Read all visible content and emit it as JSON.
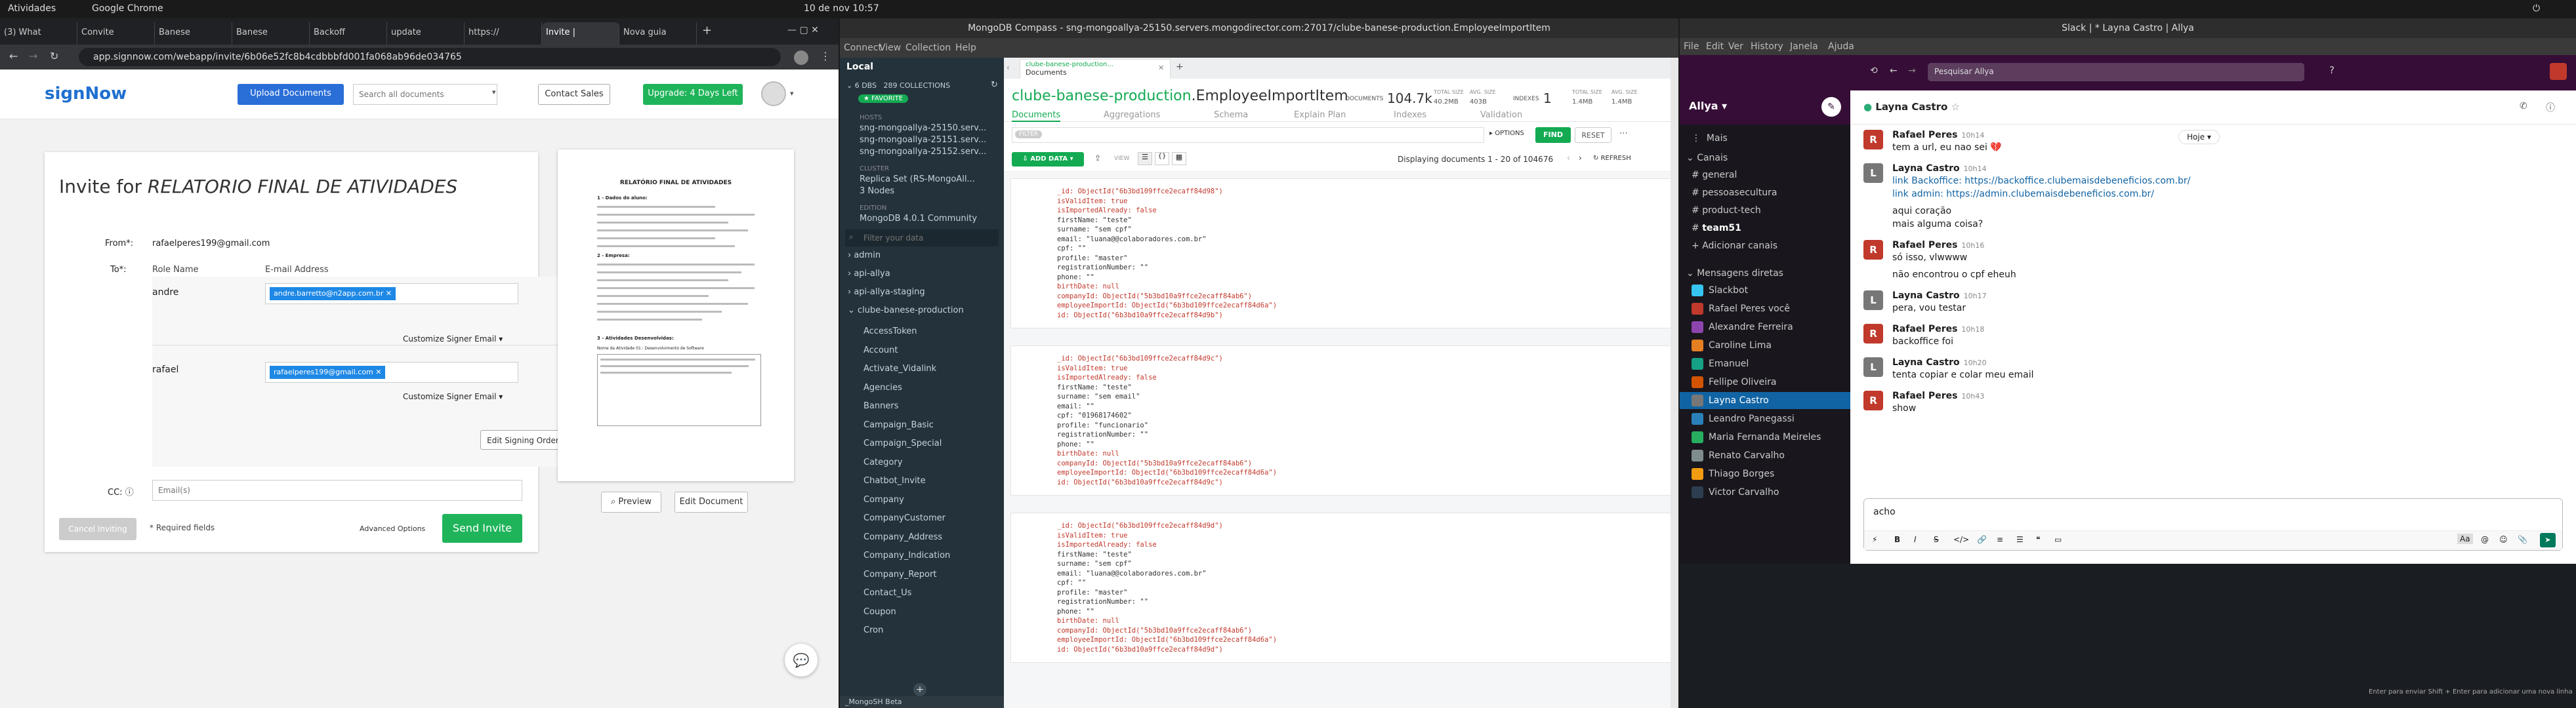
{
  "os_bar": {
    "activities": "Atividades",
    "app": "Google Chrome",
    "datetime": "10 de nov  10:57"
  },
  "chrome": {
    "tabs": [
      "(3) What",
      "Convite",
      "Banese",
      "Banese",
      "Backoff",
      "update",
      "https://",
      "Invite |",
      "Nova guia"
    ],
    "url": "app.signnow.com/webapp/invite/6b06e52fc8b4cdbbbfd001fa068ab96de034765"
  },
  "signnow": {
    "logo": "signNow",
    "upload_button": "Upload Documents",
    "search_placeholder": "Search all documents",
    "contact_sales": "Contact Sales",
    "upgrade_button": "Upgrade: 4 Days Left",
    "invite_title_prefix": "Invite for",
    "invite_title_doc": "RELATORIO FINAL DE ATIVIDADES",
    "from_label": "From*:",
    "from_value": "rafaelperes199@gmail.com",
    "to_label": "To*:",
    "role_name_header": "Role Name",
    "email_header": "E-mail Address",
    "signers": [
      {
        "role": "andre",
        "email": "andre.barretto@n2app.com.br",
        "customize": "Customize Signer Email"
      },
      {
        "role": "rafael",
        "email": "rafaelperes199@gmail.com",
        "customize": "Customize Signer Email"
      }
    ],
    "edit_signing_order": "Edit Signing Order",
    "cc_label": "CC:",
    "cc_placeholder": "Email(s)",
    "cancel_button": "Cancel Inviting",
    "required_note": "* Required fields",
    "advanced_options": "Advanced Options",
    "send_invite": "Send Invite",
    "preview_button": "Preview",
    "edit_document_button": "Edit Document",
    "preview_doc_title": "RELATÓRIO FINAL DE ATIVIDADES",
    "preview_section1": "1 - Dados do aluno:",
    "preview_section2": "2 - Empresa:",
    "preview_section3": "3 - Atividades Desenvolvidas:",
    "preview_area": "Nome da Atividade 01 : Desenvolvimento de Software"
  },
  "compass": {
    "title": "MongoDB Compass - sng-mongoallya-25150.servers.mongodirector.com:27017/clube-banese-production.EmployeeImportItem",
    "menu": [
      "Connect",
      "View",
      "Collection",
      "Help"
    ],
    "sidebar": {
      "local": "Local",
      "dbs": "6 DBS",
      "collections": "289 COLLECTIONS",
      "favorite": "FAVORITE",
      "hosts_label": "HOSTS",
      "hosts": [
        "sng-mongoallya-25150.serv...",
        "sng-mongoallya-25151.serv...",
        "sng-mongoallya-25152.serv..."
      ],
      "cluster_label": "CLUSTER",
      "cluster": "Replica Set (RS-MongoAll...",
      "nodes": "3 Nodes",
      "edition_label": "EDITION",
      "edition": "MongoDB 4.0.1 Community",
      "filter_placeholder": "Filter your data",
      "databases": [
        "admin",
        "api-allya",
        "api-allya-staging",
        "clube-banese-production"
      ],
      "collections_list": [
        "AccessToken",
        "Account",
        "Activate_Vidalink",
        "Agencies",
        "Banners",
        "Campaign_Basic",
        "Campaign_Special",
        "Category",
        "Chatbot_Invite",
        "Company",
        "CompanyCustomer",
        "Company_Address",
        "Company_Indication",
        "Company_Report",
        "Contact_Us",
        "Coupon",
        "Cron"
      ],
      "mongosh": "_MongoSH Beta"
    },
    "tab_title": "clube-banese-production...",
    "tab_sub": "Documents",
    "ns_db": "clube-banese-production",
    "ns_coll": ".EmployeeImportItem",
    "documents_label": "DOCUMENTS",
    "documents_count": "104.7k",
    "total_size_label": "TOTAL SIZE",
    "total_size": "40.2MB",
    "avg_size_label": "AVG. SIZE",
    "avg_size": "403B",
    "indexes_label": "INDEXES",
    "indexes_count": "1",
    "total_isize_label": "TOTAL SIZE",
    "total_isize": "1.4MB",
    "avg_isize_label": "AVG. SIZE",
    "avg_isize": "1.4MB",
    "subtabs": [
      "Documents",
      "Aggregations",
      "Schema",
      "Explain Plan",
      "Indexes",
      "Validation"
    ],
    "filter_tag": "FILTER",
    "options": "OPTIONS",
    "find": "FIND",
    "reset": "RESET",
    "add_data": "ADD DATA",
    "view_label": "VIEW",
    "displaying": "Displaying documents 1 - 20 of 104676",
    "refresh": "REFRESH",
    "docs": [
      [
        "_id: ObjectId(\"6b3bd109ffce2ecaff84d98\")",
        "isValidItem: true",
        "isImportedAlready: false",
        "firstName: \"teste\"",
        "surname: \"sem cpf\"",
        "email: \"luana@@colaboradores.com.br\"",
        "cpf: \"\"",
        "profile: \"master\"",
        "registrationNumber: \"\"",
        "phone: \"\"",
        "birthDate: null",
        "companyId: ObjectId(\"5b3bd10a9ffce2ecaff84ab6\")",
        "employeeImportId: ObjectId(\"6b3bd109ffce2ecaff84d6a\")",
        "id: ObjectId(\"6b3bd10a9ffce2ecaff84d9b\")"
      ],
      [
        "_id: ObjectId(\"6b3bd109ffce2ecaff84d9c\")",
        "isValidItem: true",
        "isImportedAlready: false",
        "firstName: \"teste\"",
        "surname: \"sem email\"",
        "email: \"\"",
        "cpf: \"01968174602\"",
        "profile: \"funcionario\"",
        "registrationNumber: \"\"",
        "phone: \"\"",
        "birthDate: null",
        "companyId: ObjectId(\"5b3bd10a9ffce2ecaff84ab6\")",
        "employeeImportId: ObjectId(\"6b3bd109ffce2ecaff84d6a\")",
        "id: ObjectId(\"6b3bd10a9ffce2ecaff84d9c\")"
      ],
      [
        "_id: ObjectId(\"6b3bd109ffce2ecaff84d9d\")",
        "isValidItem: true",
        "isImportedAlready: false",
        "firstName: \"teste\"",
        "surname: \"sem cpf\"",
        "email: \"luana@@colaboradores.com.br\"",
        "cpf: \"\"",
        "profile: \"master\"",
        "registrationNumber: \"\"",
        "phone: \"\"",
        "birthDate: null",
        "companyId: ObjectId(\"5b3bd10a9ffce2ecaff84ab6\")",
        "employeeImportId: ObjectId(\"6b3bd109ffce2ecaff84d6a\")",
        "id: ObjectId(\"6b3bd10a9ffce2ecaff84d9d\")"
      ]
    ]
  },
  "slack": {
    "title": "Slack | * Layna Castro | Allya",
    "menu": [
      "File",
      "Edit",
      "Ver",
      "History",
      "Janela",
      "Ajuda"
    ],
    "search": "Pesquisar Allya",
    "workspace": "Allya",
    "more": "Mais",
    "channels_header": "Canais",
    "channels": [
      "general",
      "pessoasecultura",
      "product-tech",
      "team51",
      "Adicionar canais"
    ],
    "dm_header": "Mensagens diretas",
    "dms": [
      "Slackbot",
      "Rafael Peres  você",
      "Alexandre Ferreira",
      "Caroline Lima",
      "Emanuel",
      "Fellipe Oliveira",
      "Layna Castro",
      "Leandro Panegassi",
      "Maria Fernanda Meireles",
      "Renato Carvalho",
      "Thiago Borges",
      "Victor Carvalho"
    ],
    "channel_name": "Layna Castro",
    "date_chip": "Hoje",
    "messages": [
      {
        "author": "Rafael Peres",
        "time": "10h14",
        "lines": [
          "tem a url, eu nao sei 💔"
        ],
        "color": "#c0392b",
        "initial": "R"
      },
      {
        "author": "Layna Castro",
        "time": "10h14",
        "lines": [
          "link Backoffice: https://backoffice.clubemaisdebeneficios.com.br/",
          "link admin: https://admin.clubemaisdebeneficios.com.br/",
          "",
          "aqui coração",
          "mais alguma coisa?"
        ],
        "color": "#777",
        "initial": "L"
      },
      {
        "author": "Rafael Peres",
        "time": "10h16",
        "lines": [
          "só isso, vlwwww",
          "",
          "não encontrou o cpf eheuh"
        ],
        "color": "#c0392b",
        "initial": "R"
      },
      {
        "author": "Layna Castro",
        "time": "10h17",
        "lines": [
          "pera, vou testar"
        ],
        "color": "#777",
        "initial": "L"
      },
      {
        "author": "Rafael Peres",
        "time": "10h18",
        "lines": [
          "backoffice foi"
        ],
        "color": "#c0392b",
        "initial": "R"
      },
      {
        "author": "Layna Castro",
        "time": "10h20",
        "lines": [
          "tenta copiar e colar meu email"
        ],
        "color": "#777",
        "initial": "L"
      },
      {
        "author": "Rafael Peres",
        "time": "10h43",
        "lines": [
          "show"
        ],
        "color": "#c0392b",
        "initial": "R"
      }
    ],
    "composer_text": "acho",
    "hint": "Enter para enviar   Shift + Enter para adicionar uma nova linha"
  }
}
